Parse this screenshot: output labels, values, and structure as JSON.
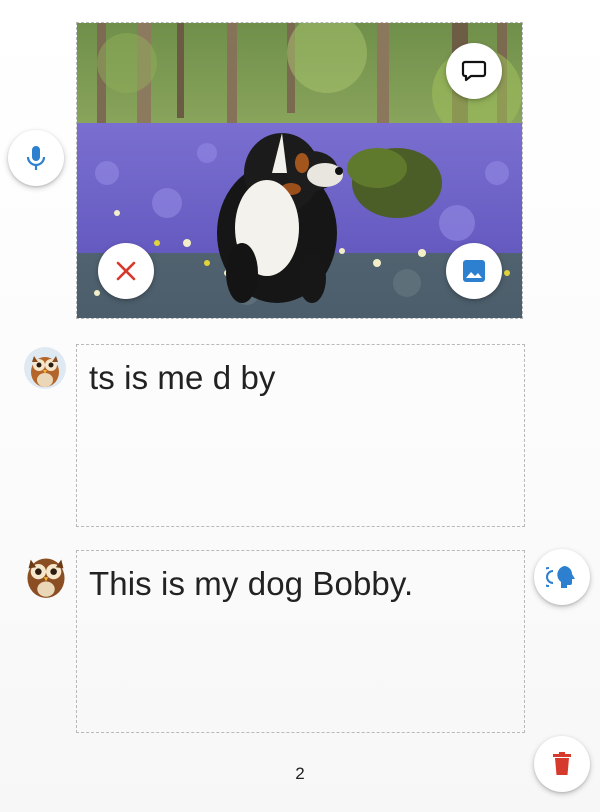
{
  "photo": {
    "subject": "Bernese mountain dog sitting in a field of bluebells"
  },
  "captions": [
    {
      "author": "owl-avatar",
      "text": "ts is me d by"
    },
    {
      "author": "owl-avatar",
      "text": "This is my dog Bobby."
    }
  ],
  "footer": {
    "page_number": "2"
  },
  "colors": {
    "mic_blue": "#2d7fd0",
    "delete_red": "#d63a2c",
    "image_blue": "#2d7fd0",
    "speak_blue": "#2d7fd0"
  }
}
